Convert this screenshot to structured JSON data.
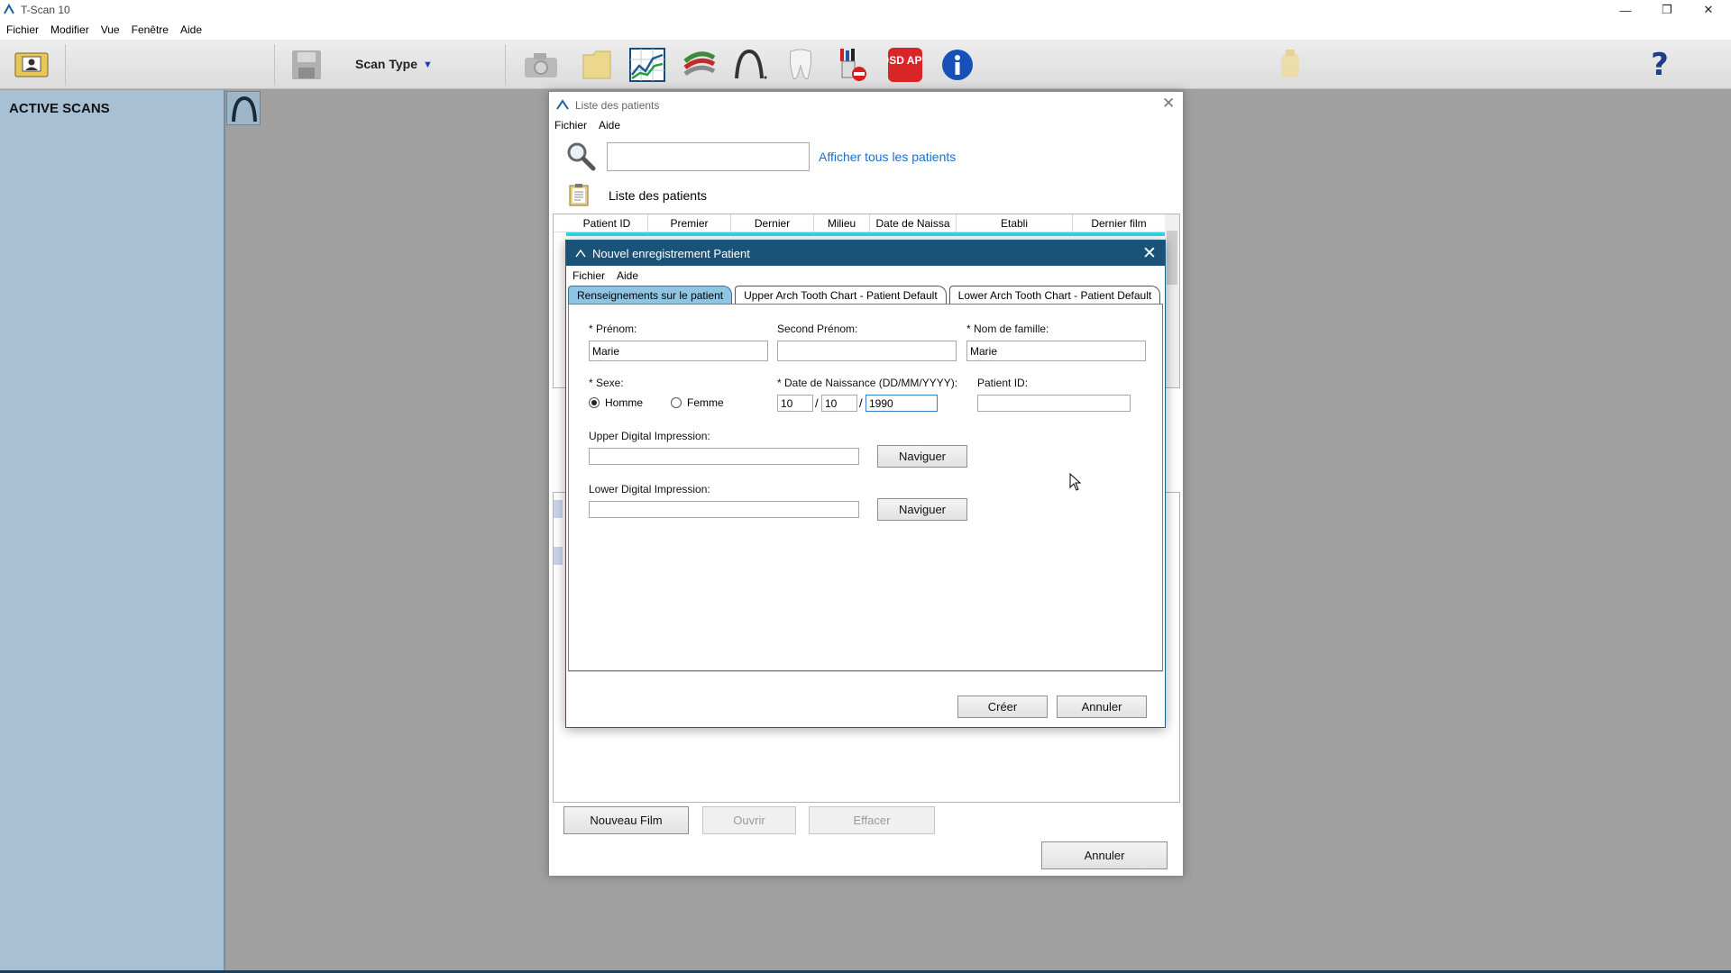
{
  "app": {
    "title": "T-Scan 10",
    "menu": [
      "Fichier",
      "Modifier",
      "Vue",
      "Fenêtre",
      "Aide"
    ],
    "window_controls": [
      "minimize",
      "restore",
      "close"
    ]
  },
  "toolbar": {
    "scan_type_label": "Scan Type",
    "icons": [
      "patient-card-icon",
      "save-icon",
      "camera-icon",
      "folder-icon",
      "graph-icon",
      "arch-layers-icon",
      "arch-icon",
      "tooth-icon",
      "sensor-icon",
      "dsd-app-icon",
      "info-icon",
      "handpiece-icon",
      "help-icon"
    ],
    "dsd_label": "DSD APP",
    "help_label": "?"
  },
  "sidebar": {
    "title": "ACTIVE SCANS"
  },
  "patient_list": {
    "title": "Liste des patients",
    "menu": [
      "Fichier",
      "Aide"
    ],
    "search_value": "",
    "show_all_label": "Afficher tous les patients",
    "list_label": "Liste des patients",
    "columns": [
      "Patient ID",
      "Premier",
      "Dernier",
      "Milieu",
      "Date de Naissa",
      "Etabli",
      "Dernier film"
    ],
    "buttons": {
      "new_film": "Nouveau Film",
      "open": "Ouvrir",
      "delete": "Effacer",
      "cancel": "Annuler"
    }
  },
  "new_patient": {
    "title": "Nouvel enregistrement Patient",
    "menu": [
      "Fichier",
      "Aide"
    ],
    "tabs": [
      "Renseignements sur le patient",
      "Upper Arch Tooth Chart - Patient Default",
      "Lower Arch Tooth Chart - Patient Default"
    ],
    "active_tab": 0,
    "fields": {
      "first_name_label": "* Prénom:",
      "first_name_value": "Marie",
      "middle_name_label": "Second Prénom:",
      "middle_name_value": "",
      "last_name_label": "* Nom de famille:",
      "last_name_value": "Marie",
      "sex_label": "* Sexe:",
      "sex_male": "Homme",
      "sex_female": "Femme",
      "sex_selected": "Homme",
      "dob_label": "* Date de Naissance (DD/MM/YYYY):",
      "dob_day": "10",
      "dob_month": "10",
      "dob_year": "1990",
      "dob_sep": "/",
      "patient_id_label": "Patient ID:",
      "patient_id_value": "",
      "upper_impression_label": "Upper Digital Impression:",
      "upper_impression_value": "",
      "lower_impression_label": "Lower Digital Impression:",
      "lower_impression_value": "",
      "browse_label": "Naviguer"
    },
    "buttons": {
      "create": "Créer",
      "cancel": "Annuler"
    }
  }
}
